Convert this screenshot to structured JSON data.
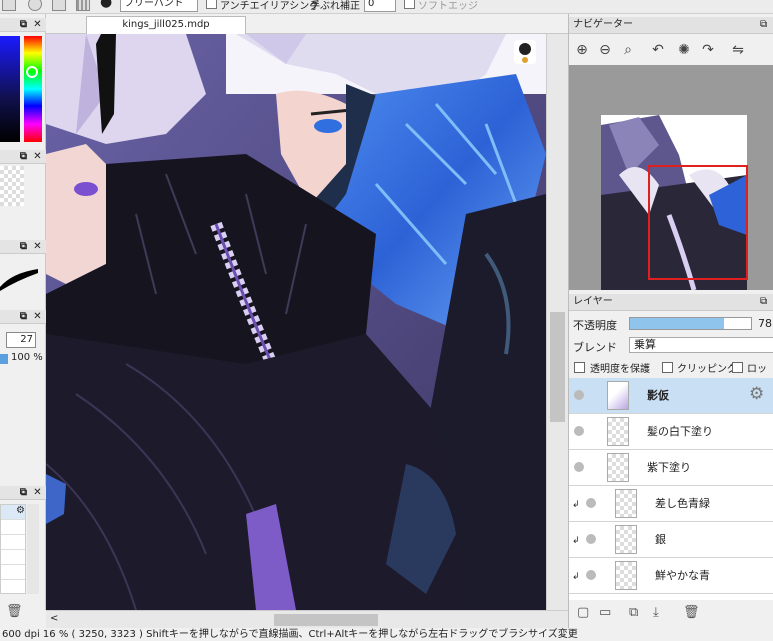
{
  "toolbar": {
    "tool_mode": "フリーハンド",
    "antialias_label": "アンチエイリアシング",
    "stabilizer_label": "手ぶれ補正",
    "stabilizer_value": "0",
    "soft_edge_label": "ソフトエッジ"
  },
  "left_panel": {
    "brush_size_value": "27",
    "opacity_value": "100 %"
  },
  "document": {
    "tab_title": "kings_jill025.mdp"
  },
  "navigator": {
    "title": "ナビゲーター",
    "icons": [
      "zoom-in-icon",
      "zoom-out-icon",
      "zoom-fit-icon",
      "rotate-left-icon",
      "rotate-reset-icon",
      "rotate-right-icon",
      "flip-icon"
    ]
  },
  "layers": {
    "title": "レイヤー",
    "opacity_label": "不透明度",
    "opacity_value": "78",
    "opacity_fraction": 0.78,
    "blend_label": "ブレンド",
    "blend_value": "乗算",
    "protect_alpha_label": "透明度を保護",
    "clipping_label": "クリッピング",
    "lock_label": "ロック",
    "items": [
      {
        "name": "影仮",
        "selected": true,
        "clipped": false
      },
      {
        "name": "髪の白下塗り",
        "selected": false,
        "clipped": false
      },
      {
        "name": "紫下塗り",
        "selected": false,
        "clipped": false
      },
      {
        "name": "差し色青緑",
        "selected": false,
        "clipped": true
      },
      {
        "name": "銀",
        "selected": false,
        "clipped": true
      },
      {
        "name": "鮮やかな青",
        "selected": false,
        "clipped": true
      }
    ]
  },
  "status": {
    "text": "600 dpi   16 %   ( 3250, 3323 )   Shiftキーを押しながらで直線描画、Ctrl+Altキーを押しながら左右ドラッグでブラシサイズ変更"
  },
  "colors": {
    "accent": "#8fc4ec",
    "selected_row": "#c9dff3",
    "nav_frame": "#e02020"
  }
}
